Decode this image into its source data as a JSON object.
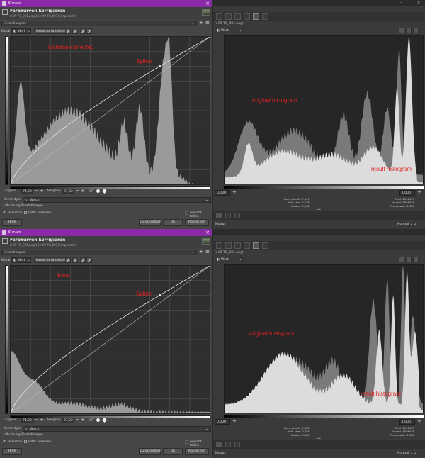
{
  "panels": [
    {
      "id": "top",
      "dialog": {
        "window_title": "Kurven",
        "header_title": "Farbkurven korrigieren",
        "header_subtitle": "(r-09-TO_001.png-1 ([r-09-TO_001] (imported))",
        "presets_label": "Einstellungen:",
        "channel_label": "Kanal:",
        "channel_value": "Wert",
        "channel_reset": "Kanal zurücksetzen",
        "input_label": "Eingabe",
        "input_value": "74,90",
        "output_label": "Ausgabe",
        "output_value": "87,92",
        "type_label": "Typ:",
        "curve_type_label": "Kurventyp:",
        "curve_type_value": "Weich",
        "blend_label": "Mischung-Einstellungen",
        "preview_label": "Vorschau",
        "split_label": "Filter vereinen",
        "split_view_label": "Ansicht teilen",
        "help_button": "Hilfe",
        "reset_button": "Zurücksetzen",
        "ok_button": "OK",
        "cancel_button": "Abbrechen",
        "annotation_main": "Gamma-corrected",
        "annotation_spline": "Spline",
        "histogram_shape": "gamma"
      },
      "dock": {
        "filename": "(r-09-TO_001.png)",
        "channel_value": "Wert",
        "range_min": "0,000",
        "range_max": "1,000",
        "stats_left_labels": [
          "Durchschnitt:",
          "Std.-Abw.:",
          "Median:"
        ],
        "stats_left_values": [
          "0,547",
          "0,278",
          "0,598"
        ],
        "stats_right_labels": [
          "Pixel:",
          "Anzahl:",
          "Prozentsatz:"
        ],
        "stats_right_values": [
          "1094419",
          "1094419",
          "100,0"
        ],
        "annotation_original": "original histogram",
        "annotation_result": "result histogram",
        "modus_label": "Modus",
        "normal_label": "Normal"
      }
    },
    {
      "id": "bottom",
      "dialog": {
        "window_title": "Kurven",
        "header_title": "Farbkurven korrigieren",
        "header_subtitle": "(r-09-TO_001.png-1 ([r-09-TO_001] (imported))",
        "presets_label": "Einstellungen:",
        "channel_label": "Kanal:",
        "channel_value": "Wert",
        "channel_reset": "Kanal zurücksetzen",
        "input_label": "Eingabe",
        "input_value": "74,90",
        "output_label": "Ausgabe",
        "output_value": "87,92",
        "type_label": "Typ:",
        "curve_type_label": "Kurventyp:",
        "curve_type_value": "Weich",
        "blend_label": "Mischung-Einstellungen",
        "preview_label": "Vorschau",
        "split_label": "Filter vereinen",
        "split_view_label": "Ansicht teilen",
        "help_button": "Hilfe",
        "reset_button": "Zurücksetzen",
        "ok_button": "OK",
        "cancel_button": "Abbrechen",
        "annotation_main": "linear",
        "annotation_spline": "Spline",
        "histogram_shape": "linear"
      },
      "dock": {
        "filename": "(r-09-TO_001.png)",
        "channel_value": "Wert",
        "range_min": "0,000",
        "range_max": "1,000",
        "stats_left_labels": [
          "Durchschnitt:",
          "Std.-Abw.:",
          "Median:"
        ],
        "stats_left_values": [
          "0,606",
          "0,283",
          "0,660"
        ],
        "stats_right_labels": [
          "Pixel:",
          "Anzahl:",
          "Prozentsatz:"
        ],
        "stats_right_values": [
          "1094419",
          "1094419",
          "100,0"
        ],
        "annotation_original": "original histogram",
        "annotation_result": "result histogram",
        "modus_label": "Modus",
        "normal_label": "Normal"
      }
    }
  ],
  "colors": {
    "titlebar": "#8a2aa8",
    "annotation": "#e02020",
    "hist_light": "#dcdcdc",
    "hist_mid": "#7a7a7a"
  }
}
